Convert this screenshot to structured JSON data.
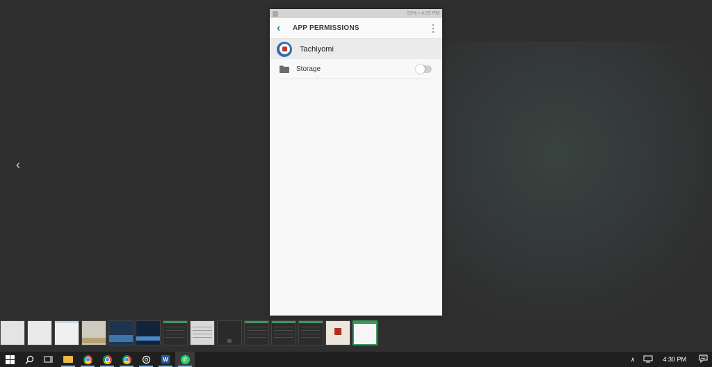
{
  "phone": {
    "statusbar": {
      "right_text": "93% ▪ 4:29 PM"
    },
    "appbar": {
      "title": "APP PERMISSIONS"
    },
    "app": {
      "name": "Tachiyomi"
    },
    "permissions": [
      {
        "label": "Storage",
        "enabled": false
      }
    ]
  },
  "taskbar": {
    "clock": "4:30 PM",
    "pinned": [
      "start-button",
      "search-button",
      "task-view-button",
      "file-explorer",
      "chrome",
      "chrome",
      "chrome",
      "openai",
      "word",
      "whatsapp"
    ]
  },
  "colors": {
    "accent": "#2a8aa6",
    "background": "#2f2f2f",
    "taskbar": "#1f1f1f",
    "active_thumb_border": "#3a9a5a"
  }
}
